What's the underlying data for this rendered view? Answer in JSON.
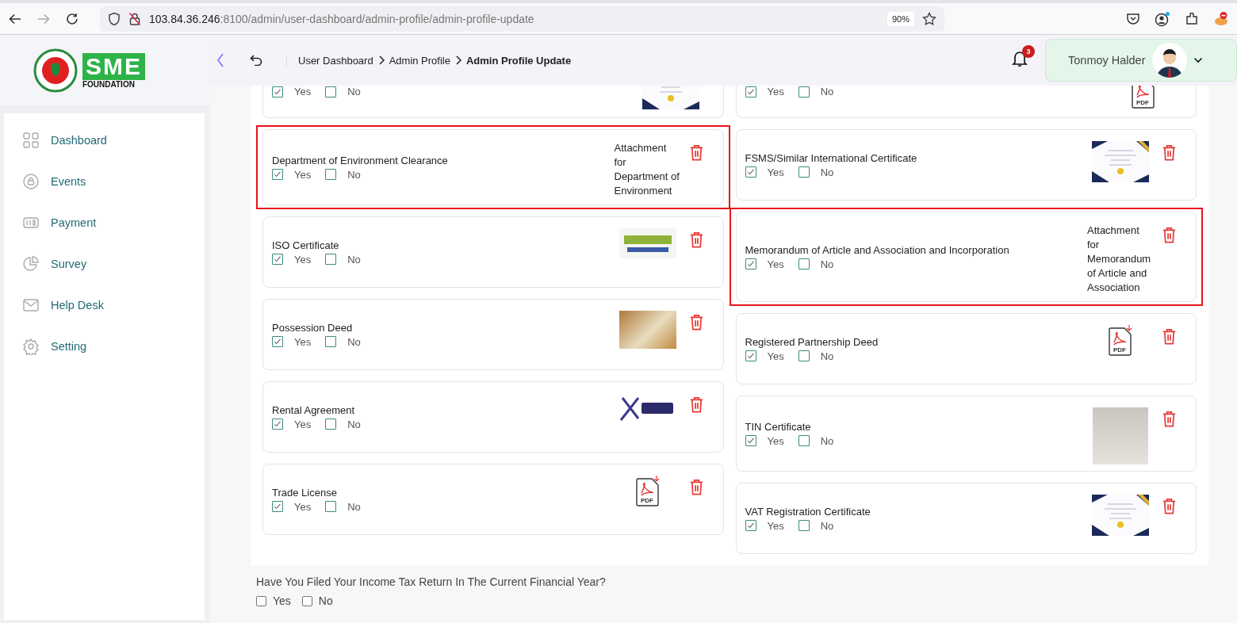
{
  "browser": {
    "url_host": "103.84.36.246",
    "url_path": ":8100/admin/user-dashboard/admin-profile/admin-profile-update",
    "zoom": "90%"
  },
  "sidebar": {
    "logo": {
      "mark": "SME",
      "caption": "FOUNDATION"
    },
    "items": [
      {
        "label": "Dashboard"
      },
      {
        "label": "Events"
      },
      {
        "label": "Payment"
      },
      {
        "label": "Survey"
      },
      {
        "label": "Help Desk"
      },
      {
        "label": "Setting"
      }
    ]
  },
  "header": {
    "breadcrumb": [
      {
        "label": "User Dashboard",
        "current": false
      },
      {
        "label": "Admin Profile",
        "current": false
      },
      {
        "label": "Admin Profile Update",
        "current": true
      }
    ],
    "notifications": "3",
    "user": {
      "name": "Tonmoy Halder"
    }
  },
  "columns": [
    {
      "cards": [
        {
          "partial": true,
          "options": [
            {
              "label": "Yes",
              "checked": true
            },
            {
              "label": "No",
              "checked": false
            }
          ],
          "attachment": {
            "kind": "certificate"
          }
        },
        {
          "title": "Department of Environment Clearance",
          "highlighted": true,
          "options": [
            {
              "label": "Yes",
              "checked": true
            },
            {
              "label": "No",
              "checked": false
            }
          ],
          "attachment": {
            "kind": "text",
            "text": "Attachment for Department of Environment"
          }
        },
        {
          "title": "ISO Certificate",
          "options": [
            {
              "label": "Yes",
              "checked": true
            },
            {
              "label": "No",
              "checked": false
            }
          ],
          "attachment": {
            "kind": "logo"
          }
        },
        {
          "title": "Possession Deed",
          "options": [
            {
              "label": "Yes",
              "checked": true
            },
            {
              "label": "No",
              "checked": false
            }
          ],
          "attachment": {
            "kind": "photo"
          }
        },
        {
          "title": "Rental Agreement",
          "options": [
            {
              "label": "Yes",
              "checked": true
            },
            {
              "label": "No",
              "checked": false
            }
          ],
          "attachment": {
            "kind": "emblem"
          }
        },
        {
          "title": "Trade License",
          "options": [
            {
              "label": "Yes",
              "checked": true
            },
            {
              "label": "No",
              "checked": false
            }
          ],
          "attachment": {
            "kind": "pdf",
            "label": "PDF"
          }
        }
      ]
    },
    {
      "cards": [
        {
          "partial": true,
          "options": [
            {
              "label": "Yes",
              "checked": true
            },
            {
              "label": "No",
              "checked": false
            }
          ],
          "attachment": {
            "kind": "pdf",
            "label": "PDF"
          }
        },
        {
          "title": "FSMS/Similar International Certificate",
          "options": [
            {
              "label": "Yes",
              "checked": true
            },
            {
              "label": "No",
              "checked": false
            }
          ],
          "attachment": {
            "kind": "certificate"
          }
        },
        {
          "title": "Memorandum of Article and Association and Incorporation",
          "highlighted": true,
          "options": [
            {
              "label": "Yes",
              "checked": true
            },
            {
              "label": "No",
              "checked": false
            }
          ],
          "attachment": {
            "kind": "text",
            "text": "Attachment for Memorandum of Article and Association"
          }
        },
        {
          "title": "Registered Partnership Deed",
          "options": [
            {
              "label": "Yes",
              "checked": true
            },
            {
              "label": "No",
              "checked": false
            }
          ],
          "attachment": {
            "kind": "pdf",
            "label": "PDF"
          }
        },
        {
          "title": "TIN Certificate",
          "options": [
            {
              "label": "Yes",
              "checked": true
            },
            {
              "label": "No",
              "checked": false
            }
          ],
          "attachment": {
            "kind": "portrait"
          }
        },
        {
          "title": "VAT Registration Certificate",
          "options": [
            {
              "label": "Yes",
              "checked": true
            },
            {
              "label": "No",
              "checked": false
            }
          ],
          "attachment": {
            "kind": "certificate"
          }
        }
      ]
    }
  ],
  "question": {
    "text": "Have You Filed Your Income Tax Return In The Current Financial Year?",
    "options": [
      {
        "label": "Yes",
        "checked": false
      },
      {
        "label": "No",
        "checked": false
      }
    ]
  }
}
